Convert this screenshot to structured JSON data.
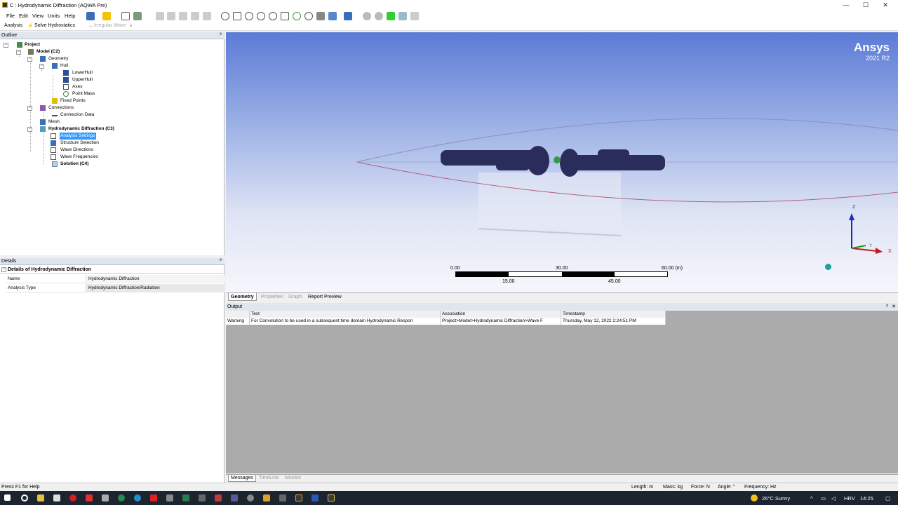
{
  "window": {
    "title": "C : Hydrodynamic Diffraction (AQWA Pre)",
    "minimize": "—",
    "maximize": "☐",
    "close": "✕"
  },
  "menu": {
    "items": [
      "File",
      "Edit",
      "View",
      "Units",
      "Help"
    ]
  },
  "toolbar2": {
    "analysis": "Analysis",
    "solve": "Solve Hydrostatics",
    "irregular": "Irregular Wave"
  },
  "outline": {
    "title": "Outline",
    "pin": "ᵖ",
    "nodes": [
      {
        "label": "Project",
        "bold": true
      },
      {
        "label": "Model (C2)",
        "bold": true
      },
      {
        "label": "Geometry"
      },
      {
        "label": "Hull"
      },
      {
        "label": "LowerHull"
      },
      {
        "label": "UpperHull"
      },
      {
        "label": "Axes"
      },
      {
        "label": "Point Mass"
      },
      {
        "label": "Fixed Points"
      },
      {
        "label": "Connections"
      },
      {
        "label": "Connection Data"
      },
      {
        "label": "Mesh"
      },
      {
        "label": "Hydrodynamic Diffraction (C3)",
        "bold": true
      },
      {
        "label": "Analysis Settings",
        "selected": true
      },
      {
        "label": "Structure Selection"
      },
      {
        "label": "Wave Directions"
      },
      {
        "label": "Wave Frequencies"
      },
      {
        "label": "Solution (C4)",
        "bold": true
      }
    ]
  },
  "details": {
    "title": "Details",
    "group": "Details of Hydrodynamic Diffraction",
    "rows": [
      {
        "k": "Name",
        "v": "Hydrodynamic Diffraction"
      },
      {
        "k": "Analysis Type",
        "v": "Hydrodynamic Diffraction/Radiation"
      }
    ]
  },
  "viewport": {
    "brand": "Ansys",
    "version": "2021 R2",
    "scale": {
      "top": [
        "0.00",
        "30.00",
        "60.00 (m)"
      ],
      "bottom": [
        "15.00",
        "45.00"
      ]
    },
    "axes": {
      "z": "Z",
      "x": "X",
      "y": "Y"
    }
  },
  "geotabs": [
    "Geometry",
    "Properties",
    "Graph",
    "Report Preview"
  ],
  "output": {
    "title": "Output",
    "pin": "ᵖ",
    "close": "✕",
    "headers": [
      "Text",
      "Association",
      "Timestamp"
    ],
    "row": {
      "type": "Warning",
      "text": "For Convolution to be used in a subsequent time domain Hydrodynamic Respon",
      "assoc": "Project>Model>Hydrodynamic Diffraction>Wave F",
      "time": "Thursday, May 12, 2022 2:24:51 PM"
    }
  },
  "msgtabs": [
    "Messages",
    "TimeLine",
    "Monitor"
  ],
  "status": {
    "help": "Press F1 for Help",
    "length": "Length: m",
    "mass": "Mass: kg",
    "force": "Force: N",
    "angle": "Angle: °",
    "freq": "Frequency: Hz"
  },
  "taskbar": {
    "weather": "26°C  Sunny",
    "lang": "HRV",
    "time": "14:25"
  },
  "colors": {
    "accent": "#3399ff",
    "viewport_top": "#5b7bd6",
    "hull": "#2a2d5c"
  }
}
